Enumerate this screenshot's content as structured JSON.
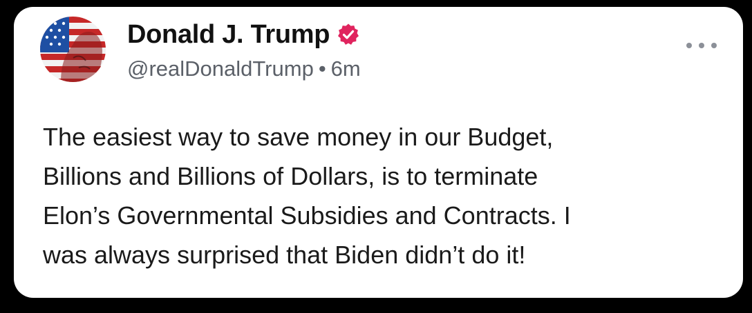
{
  "post": {
    "author": {
      "display_name": "Donald J. Trump",
      "handle": "@realDonaldTrump",
      "verified": true,
      "avatar_icon": "flag-portrait-avatar"
    },
    "separator": "•",
    "timestamp": "6m",
    "more_icon": "more-horizontal-icon",
    "body_lines": [
      "The easiest way to save money in our Budget,",
      "Billions and Billions of Dollars, is to terminate",
      "Elon’s Governmental Subsidies and Contracts. I",
      "was always surprised that Biden didn’t do it!"
    ]
  },
  "colors": {
    "verified_badge": "#e0245e",
    "text_primary": "#111111",
    "text_secondary": "#5b6068",
    "background": "#ffffff"
  }
}
